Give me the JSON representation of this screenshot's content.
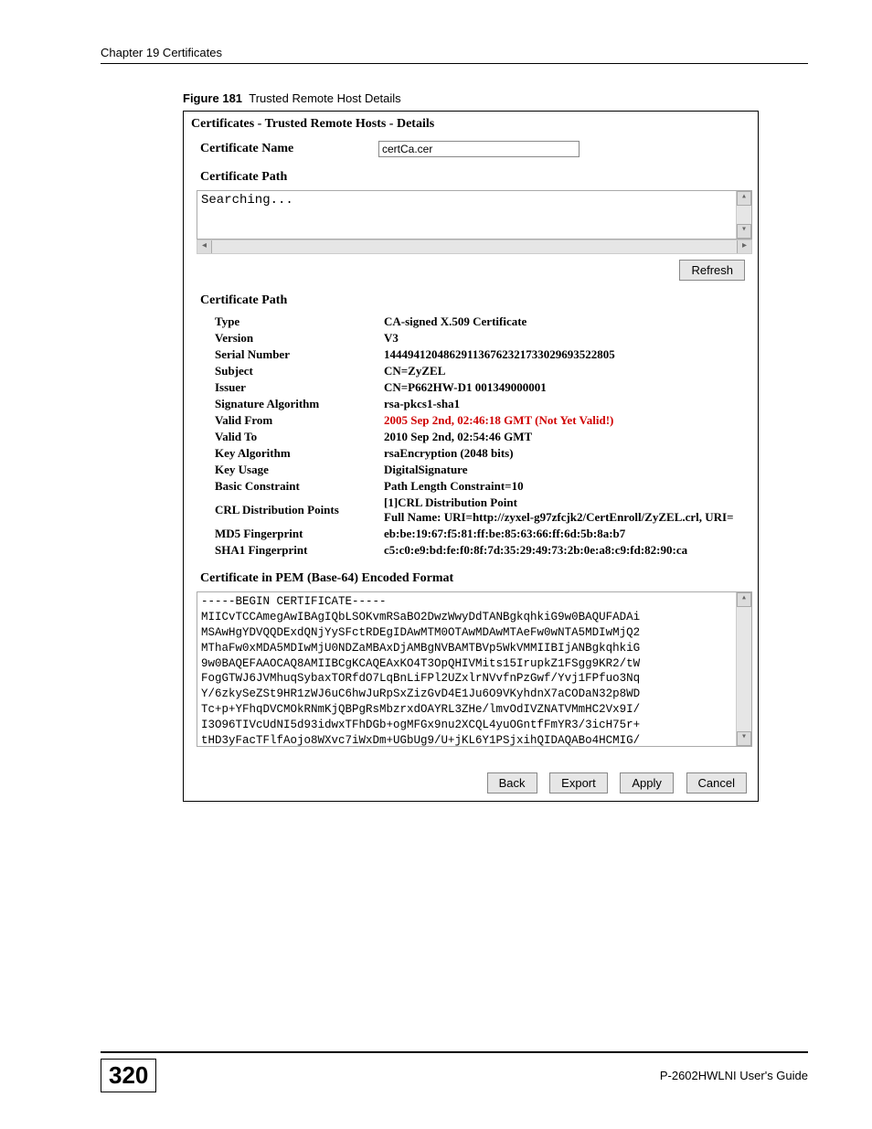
{
  "header": {
    "chapter": "Chapter 19 Certificates"
  },
  "figure": {
    "label_prefix": "Figure 181",
    "label_text": "Trusted Remote Host Details",
    "crumb": "Certificates - Trusted Remote Hosts - Details",
    "cert_name_label": "Certificate Name",
    "cert_name_value": "certCa.cer",
    "cert_path_label": "Certificate Path",
    "searching_text": "Searching...",
    "refresh_label": "Refresh",
    "cert_path_label2": "Certificate Path",
    "details": {
      "type_label": "Type",
      "type_value": "CA-signed X.509 Certificate",
      "version_label": "Version",
      "version_value": "V3",
      "serial_label": "Serial Number",
      "serial_value": "144494120486291136762321733029693522805",
      "subject_label": "Subject",
      "subject_value": "CN=ZyZEL",
      "issuer_label": "Issuer",
      "issuer_value": "CN=P662HW-D1 001349000001",
      "sigalg_label": "Signature Algorithm",
      "sigalg_value": "rsa-pkcs1-sha1",
      "validfrom_label": "Valid From",
      "validfrom_value": "2005 Sep 2nd, 02:46:18 GMT (Not Yet Valid!)",
      "validto_label": "Valid To",
      "validto_value": "2010 Sep 2nd, 02:54:46 GMT",
      "keyalg_label": "Key Algorithm",
      "keyalg_value": "rsaEncryption (2048 bits)",
      "keyusage_label": "Key Usage",
      "keyusage_value": "DigitalSignature",
      "basic_label": "Basic Constraint",
      "basic_value": "Path Length Constraint=10",
      "crl_label": "CRL Distribution Points",
      "crl_value1": "[1]CRL Distribution Point",
      "crl_value2": "Full Name: URI=http://zyxel-g97zfcjk2/CertEnroll/ZyZEL.crl, URI=",
      "md5_label": "MD5 Fingerprint",
      "md5_value": "eb:be:19:67:f5:81:ff:be:85:63:66:ff:6d:5b:8a:b7",
      "sha1_label": "SHA1 Fingerprint",
      "sha1_value": "c5:c0:e9:bd:fe:f0:8f:7d:35:29:49:73:2b:0e:a8:c9:fd:82:90:ca"
    },
    "pem_label": "Certificate in PEM (Base-64) Encoded Format",
    "pem_text": "-----BEGIN CERTIFICATE-----\nMIICvTCCAmegAwIBAgIQbLSOKvmRSaBO2DwzWwyDdTANBgkqhkiG9w0BAQUFADAi\nMSAwHgYDVQQDExdQNjYySFctRDEgIDAwMTM0OTAwMDAwMTAeFw0wNTA5MDIwMjQ2\nMThaFw0xMDA5MDIwMjU0NDZaMBAxDjAMBgNVBAMTBVp5WkVMMIIBIjANBgkqhkiG\n9w0BAQEFAAOCAQ8AMIIBCgKCAQEAxKO4T3OpQHIVMits15IrupkZ1FSgg9KR2/tW\nFogGTWJ6JVMhuqSybaxTORfdO7LqBnLiFPl2UZxlrNVvfnPzGwf/Yvj1FPfuo3Nq\nY/6zkySeZSt9HR1zWJ6uC6hwJuRpSxZizGvD4E1Ju6O9VKyhdnX7aCODaN32p8WD\nTc+p+YFhqDVCMOkRNmKjQBPgRsMbzrxdOAYRL3ZHe/lmvOdIVZNATVMmHC2Vx9I/\nI3O96TIVcUdNI5d93idwxTFhDGb+ogMFGx9nu2XCQL4yuOGntfFmYR3/3icH75r+\ntHD3yFacTFlfAojo8WXvc7iWxDm+UGbUg9/U+jKL6Y1PSjxihQIDAQABo4HCMIG/",
    "buttons": {
      "back": "Back",
      "export": "Export",
      "apply": "Apply",
      "cancel": "Cancel"
    }
  },
  "footer": {
    "page": "320",
    "guide": "P-2602HWLNI User's Guide"
  }
}
